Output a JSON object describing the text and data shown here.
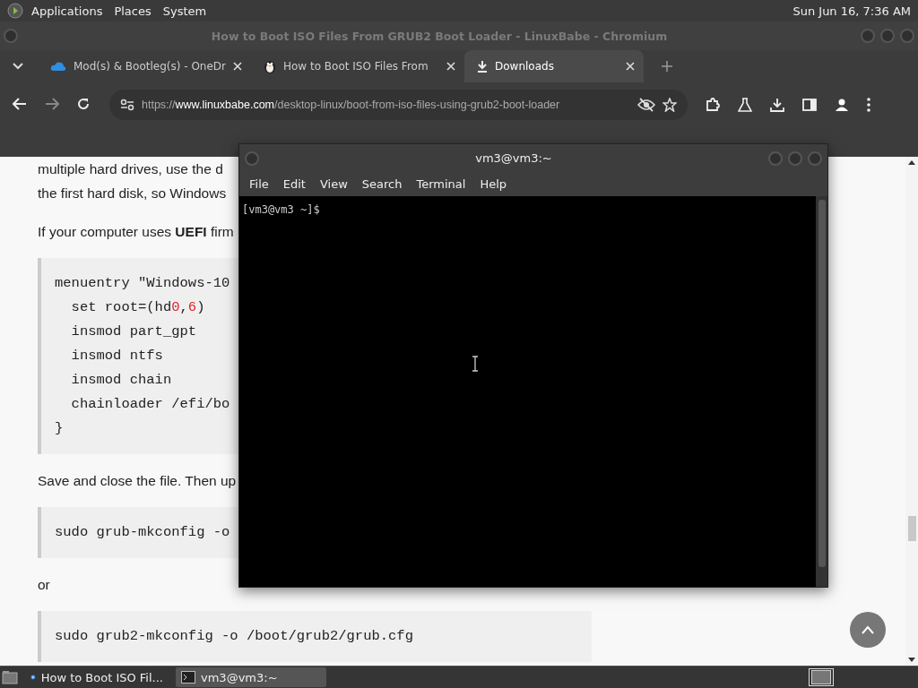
{
  "top_panel": {
    "menus": [
      "Applications",
      "Places",
      "System"
    ],
    "clock": "Sun Jun 16, 7:36 AM"
  },
  "browser": {
    "title": "How to Boot ISO Files From GRUB2 Boot Loader - LinuxBabe - Chromium",
    "tabs": [
      {
        "label": "Mod(s) & Bootleg(s) - OneDr",
        "kind": "cloud",
        "selected": false
      },
      {
        "label": "How to Boot ISO Files From",
        "kind": "penguin",
        "selected": false
      },
      {
        "label": "Downloads",
        "kind": "download",
        "selected": true
      }
    ],
    "url": {
      "scheme": "https://",
      "host": "www.linuxbabe.com",
      "path": "/desktop-linux/boot-from-iso-files-using-grub2-boot-loader"
    },
    "content": [
      {
        "kind": "text",
        "lines": [
          "multiple hard drives, use the d",
          "the first hard disk, so Windows"
        ]
      },
      {
        "kind": "text",
        "lines": [
          "If your computer uses **UEFI** firm"
        ]
      },
      {
        "kind": "code",
        "lines": [
          [
            {
              "text": "menuentry \"Windows-10",
              "kind": "plain"
            }
          ],
          [
            {
              "text": "  set root=(hd",
              "kind": "plain"
            },
            {
              "text": "0",
              "kind": "number"
            },
            {
              "text": ",",
              "kind": "plain"
            },
            {
              "text": "6",
              "kind": "number"
            },
            {
              "text": ")",
              "kind": "plain"
            }
          ],
          [
            {
              "text": "  insmod part_gpt",
              "kind": "plain"
            }
          ],
          [
            {
              "text": "  insmod ntfs",
              "kind": "plain"
            }
          ],
          [
            {
              "text": "  insmod chain",
              "kind": "plain"
            }
          ],
          [
            {
              "text": "  chainloader /efi/bo",
              "kind": "plain"
            }
          ],
          [
            {
              "text": "}",
              "kind": "plain"
            }
          ]
        ]
      },
      {
        "kind": "text",
        "lines": [
          "Save and close the file. Then up"
        ]
      },
      {
        "kind": "code",
        "lines": [
          [
            {
              "text": "sudo grub-mkconfig -o",
              "kind": "plain"
            }
          ]
        ]
      },
      {
        "kind": "text",
        "lines": [
          "or"
        ]
      },
      {
        "kind": "code",
        "lines": [
          [
            {
              "text": "sudo grub2-mkconfig -o /boot/grub2/grub.cfg",
              "kind": "plain"
            }
          ]
        ]
      }
    ]
  },
  "terminal": {
    "title": "vm3@vm3:~",
    "menus": [
      "File",
      "Edit",
      "View",
      "Search",
      "Terminal",
      "Help"
    ],
    "prompt": "[vm3@vm3 ~]$"
  },
  "taskbar": {
    "items": [
      {
        "label": "How to Boot ISO Fil...",
        "kind": "browser",
        "selected": false
      },
      {
        "label": "vm3@vm3:~",
        "kind": "terminal",
        "selected": true
      }
    ]
  }
}
